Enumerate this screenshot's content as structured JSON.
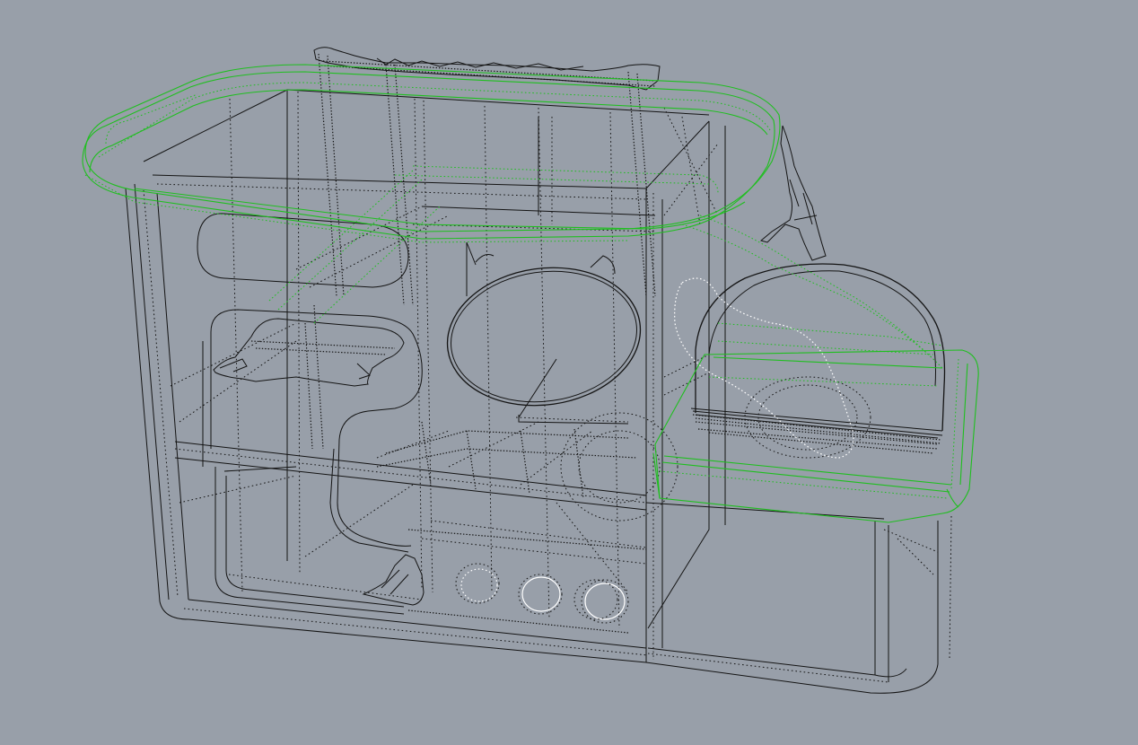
{
  "viewport": {
    "background_color": "#989fa9",
    "wire_color": "#141414",
    "selection_color": "#1fbf1f",
    "highlight_color": "#ffffff",
    "display_mode": "wireframe"
  },
  "objects": [
    {
      "name": "cage-body",
      "selected": false
    },
    {
      "name": "top-rim",
      "selected": true
    },
    {
      "name": "side-tub",
      "selected": true
    },
    {
      "name": "hammock-top",
      "selected": false
    },
    {
      "name": "hammock-middle",
      "selected": false
    },
    {
      "name": "hammock-bottom",
      "selected": false
    },
    {
      "name": "exercise-wheel",
      "selected": false
    },
    {
      "name": "tunnel-arch",
      "selected": false
    },
    {
      "name": "vent-holes",
      "selected": false
    }
  ]
}
